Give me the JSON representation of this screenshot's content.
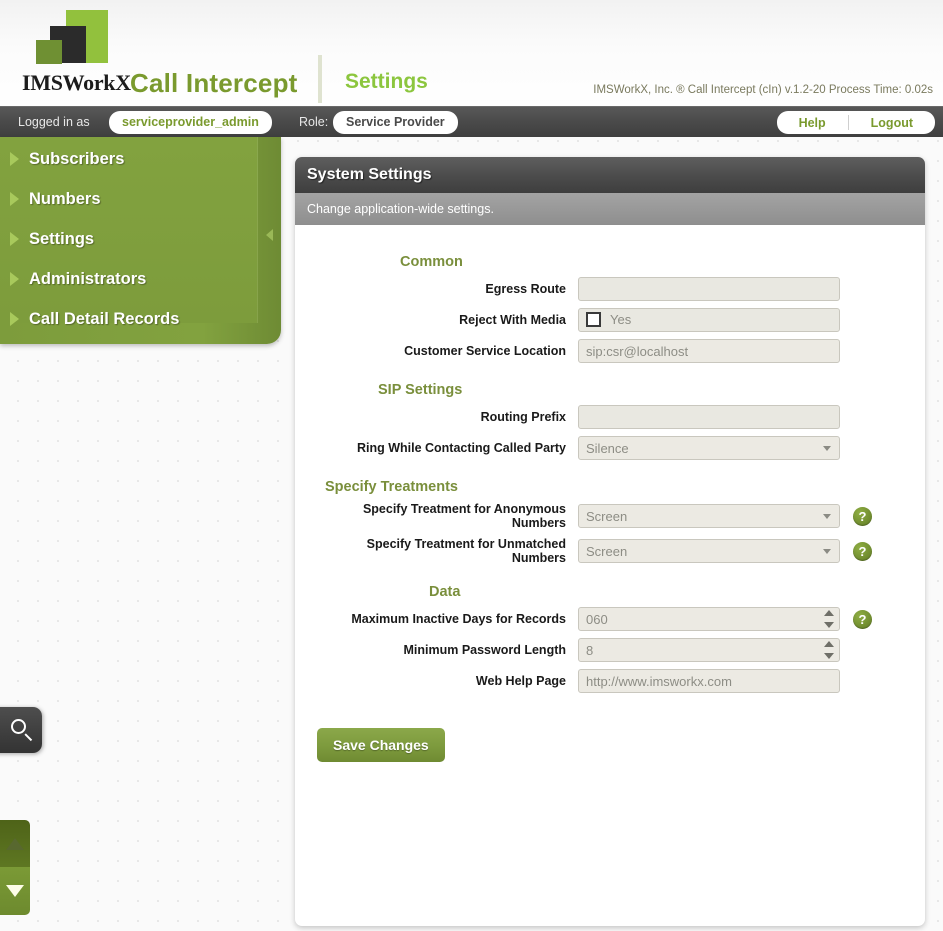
{
  "header": {
    "brand": "IMSWorkX",
    "app_title": "Call Intercept",
    "page_title": "Settings",
    "meta": "IMSWorkX, Inc. ® Call Intercept (cIn) v.1.2-20  Process Time: 0.02s"
  },
  "login_bar": {
    "logged_in_label": "Logged in as",
    "username": "serviceprovider_admin",
    "role_label": "Role:",
    "role_value": "Service Provider",
    "help_label": "Help",
    "logout_label": "Logout"
  },
  "sidebar": {
    "items": [
      {
        "label": "Subscribers"
      },
      {
        "label": "Numbers"
      },
      {
        "label": "Settings"
      },
      {
        "label": "Administrators"
      },
      {
        "label": "Call Detail Records"
      }
    ]
  },
  "panel": {
    "title": "System Settings",
    "subtitle": "Change application-wide settings."
  },
  "form": {
    "sections": {
      "common": "Common",
      "sip": "SIP Settings",
      "treatments": "Specify Treatments",
      "data": "Data"
    },
    "fields": {
      "egress_route": {
        "label": "Egress Route",
        "value": "",
        "placeholder": ""
      },
      "reject_with_media": {
        "label": "Reject With Media",
        "checkbox_text": "Yes",
        "checked": false
      },
      "customer_service_location": {
        "label": "Customer Service Location",
        "value": "sip:csr@localhost"
      },
      "routing_prefix": {
        "label": "Routing Prefix",
        "value": "",
        "placeholder": ""
      },
      "ring_while_contacting": {
        "label": "Ring While Contacting Called Party",
        "value": "Silence"
      },
      "treatment_anonymous": {
        "label": "Specify Treatment for Anonymous Numbers",
        "value": "Screen"
      },
      "treatment_unmatched": {
        "label": "Specify Treatment for Unmatched Numbers",
        "value": "Screen"
      },
      "max_inactive_days": {
        "label": "Maximum Inactive Days for Records",
        "value": "060"
      },
      "min_password_length": {
        "label": "Minimum Password Length",
        "value": "8"
      },
      "web_help_page": {
        "label": "Web Help Page",
        "value": "http://www.imsworkx.com"
      }
    },
    "help_icon_glyph": "?",
    "save_label": "Save Changes"
  },
  "colors": {
    "brand_green": "#8cc63e",
    "olive": "#7a9a2e",
    "sidebar_green": "#82a23f",
    "panel_title_gray": "#4b4b4b"
  }
}
